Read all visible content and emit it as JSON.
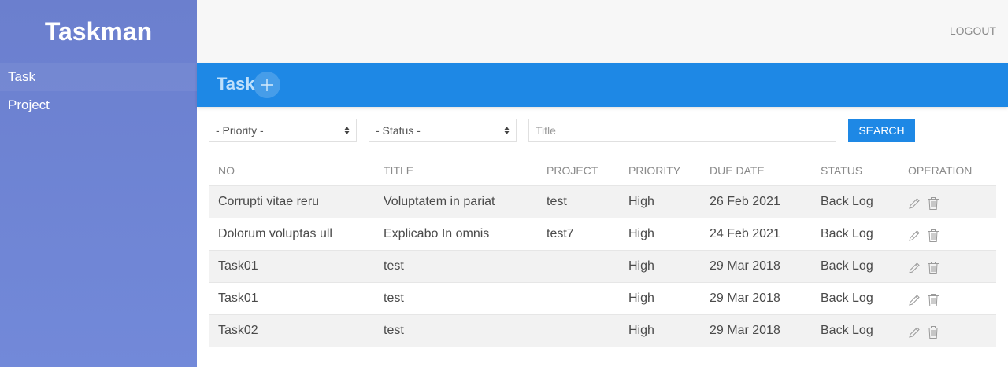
{
  "brand": "Taskman",
  "sidebar": {
    "items": [
      {
        "label": "Task"
      },
      {
        "label": "Project"
      }
    ]
  },
  "topbar": {
    "logout_label": "LOGOUT"
  },
  "page": {
    "title": "Task"
  },
  "filters": {
    "priority_selected": "- Priority -",
    "status_selected": "- Status -",
    "title_placeholder": "Title",
    "search_label": "SEARCH"
  },
  "table": {
    "headers": [
      "NO",
      "TITLE",
      "PROJECT",
      "PRIORITY",
      "DUE DATE",
      "STATUS",
      "OPERATION"
    ],
    "rows": [
      {
        "no": "Corrupti vitae reru",
        "title": "Voluptatem in pariat",
        "project": "test",
        "priority": "High",
        "due": "26 Feb 2021",
        "status": "Back Log"
      },
      {
        "no": "Dolorum voluptas ull",
        "title": "Explicabo In omnis",
        "project": "test7",
        "priority": "High",
        "due": "24 Feb 2021",
        "status": "Back Log"
      },
      {
        "no": "Task01",
        "title": "test",
        "project": "",
        "priority": "High",
        "due": "29 Mar 2018",
        "status": "Back Log"
      },
      {
        "no": "Task01",
        "title": "test",
        "project": "",
        "priority": "High",
        "due": "29 Mar 2018",
        "status": "Back Log"
      },
      {
        "no": "Task02",
        "title": "test",
        "project": "",
        "priority": "High",
        "due": "29 Mar 2018",
        "status": "Back Log"
      }
    ]
  },
  "icons": {
    "add": "plus-icon",
    "edit": "pencil-icon",
    "delete": "trash-icon",
    "select": "sort-arrows-icon"
  },
  "colors": {
    "sidebar": "#6b7fce",
    "primary": "#1e88e5",
    "topbar": "#f7f7f7",
    "stripe": "#f2f2f2"
  }
}
